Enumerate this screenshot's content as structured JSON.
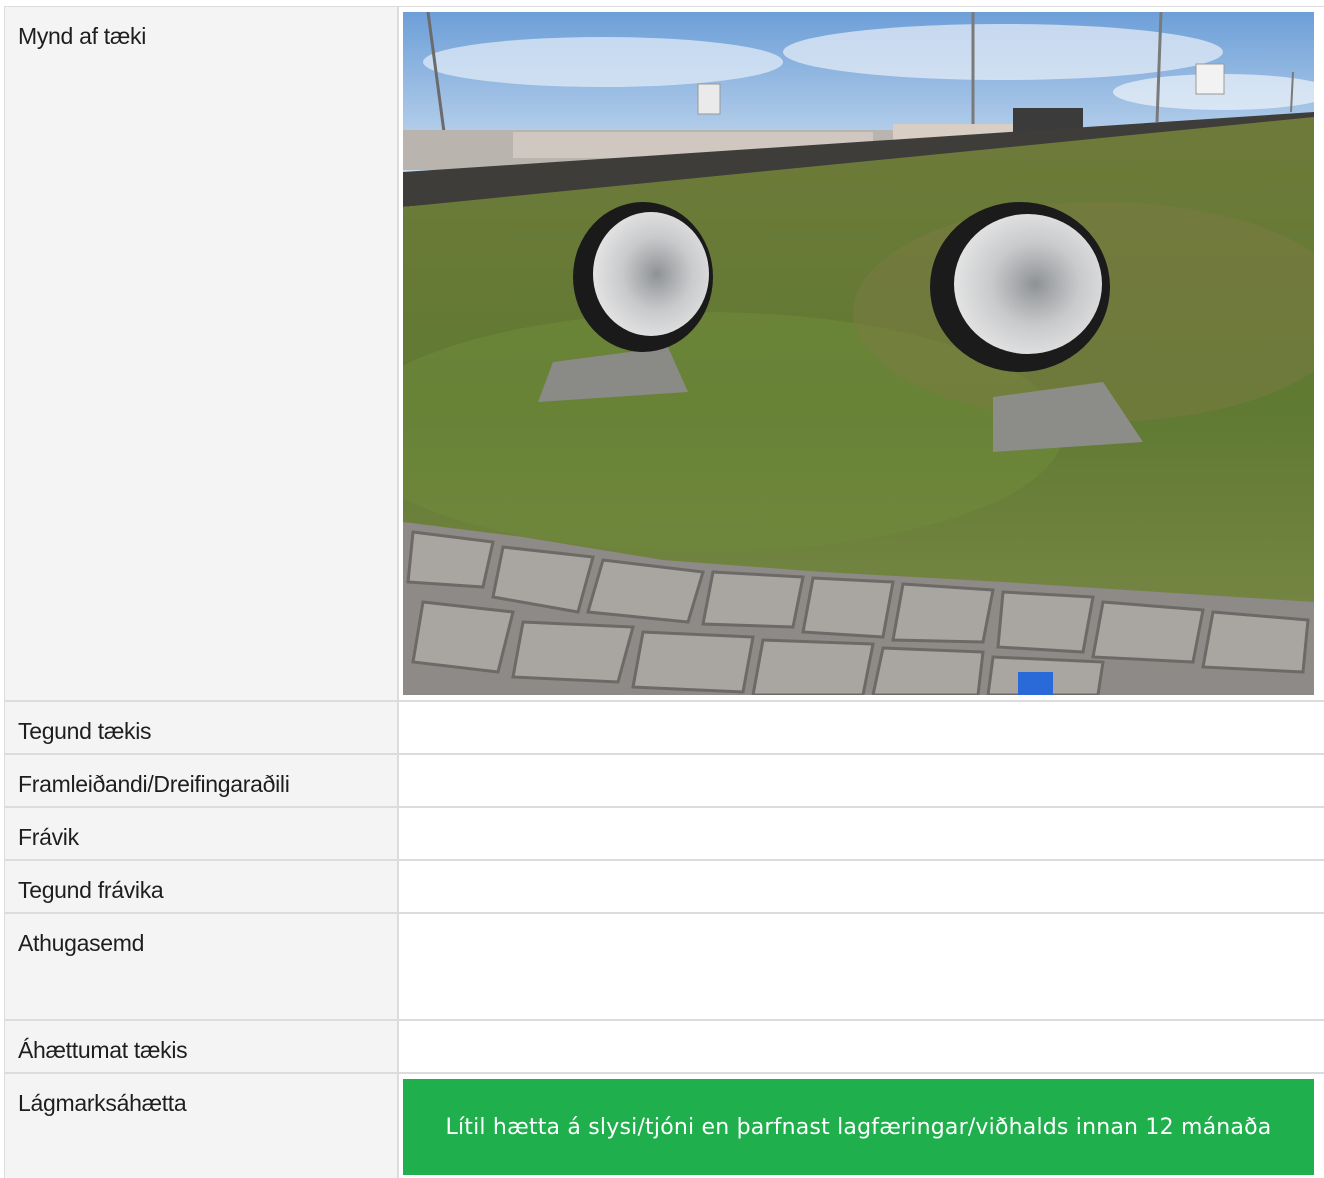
{
  "fields": {
    "image_label": "Mynd af tæki",
    "equipment_type_label": "Tegund tækis",
    "manufacturer_label": "Framleiðandi/Dreifingaraðili",
    "deviation_label": "Frávik",
    "deviation_type_label": "Tegund frávika",
    "comment_label": "Athugasemd",
    "risk_assessment_label": "Áhættumat tækis",
    "risk_level_label": "Lágmarksáhætta"
  },
  "risk": {
    "description": "Lítil hætta á slysi/tjóni en þarfnast lagfæringar/viðhalds innan 12 mánaða",
    "color": "#1fb04d"
  },
  "photo": {
    "subject": "two-pipe-tunnels-in-grass-mound"
  }
}
